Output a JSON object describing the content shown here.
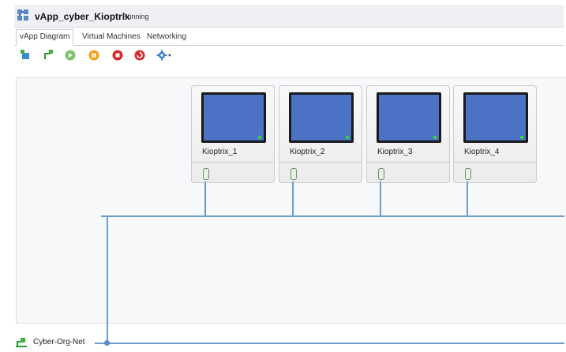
{
  "window": {
    "title": "vApp_cyber_Kioptrix",
    "status": "Running"
  },
  "tabs": [
    "vApp Diagram",
    "Virtual Machines",
    "Networking"
  ],
  "toolbar": [
    {
      "icon": "add-vm-icon"
    },
    {
      "icon": "add-network-icon"
    },
    {
      "icon": "power-on-icon"
    },
    {
      "icon": "suspend-icon"
    },
    {
      "icon": "power-off-icon"
    },
    {
      "icon": "reset-icon"
    },
    {
      "icon": "settings-dropdown-icon"
    }
  ],
  "vms": [
    {
      "name": "Kioptrix_1"
    },
    {
      "name": "Kioptrix_2"
    },
    {
      "name": "Kioptrix_3"
    },
    {
      "name": "Kioptrix_4"
    }
  ],
  "network": {
    "name": "Cyber-Org-Net"
  },
  "colors": {
    "screen": "#4b72c4",
    "network_line": "#6a9ccc",
    "running_led": "#3cd33c"
  }
}
